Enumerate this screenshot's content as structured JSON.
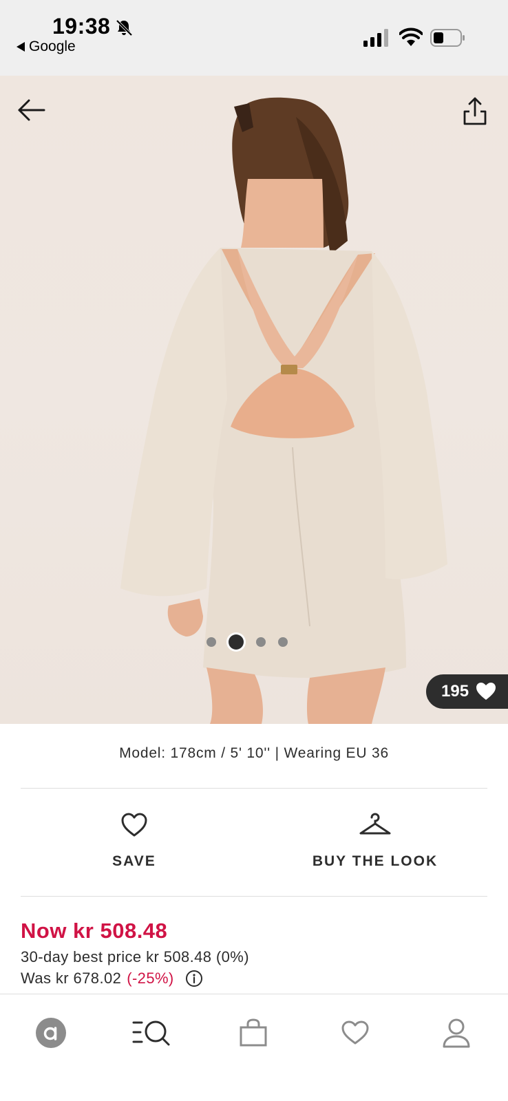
{
  "status_bar": {
    "time": "19:38",
    "back_app_label": "Google",
    "icons": [
      "bell-slash-icon",
      "cellular-signal-icon",
      "wifi-icon",
      "battery-icon"
    ]
  },
  "hero": {
    "icons": [
      "arrow-left-icon",
      "share-icon",
      "heart-icon"
    ],
    "carousel": {
      "count": 4,
      "active_index": 1
    },
    "likes_count": "195"
  },
  "product": {
    "model_info": "Model: 178cm / 5' 10'' | Wearing EU 36"
  },
  "actions": {
    "save_label": "SAVE",
    "buy_the_look_label": "BUY THE LOOK"
  },
  "price": {
    "now": "Now kr 508.48",
    "best_price": "30-day best price kr 508.48 (0%)",
    "was": "Was kr 678.02",
    "discount": "(-25%)"
  },
  "bottom_nav": {
    "items": [
      "home-icon",
      "search-icon",
      "bag-icon",
      "saved-icon",
      "account-icon"
    ]
  },
  "colors": {
    "sale": "#d01345",
    "text": "#2d2d2d",
    "status_bar_bg": "#efefef",
    "divider": "#dddddd"
  }
}
